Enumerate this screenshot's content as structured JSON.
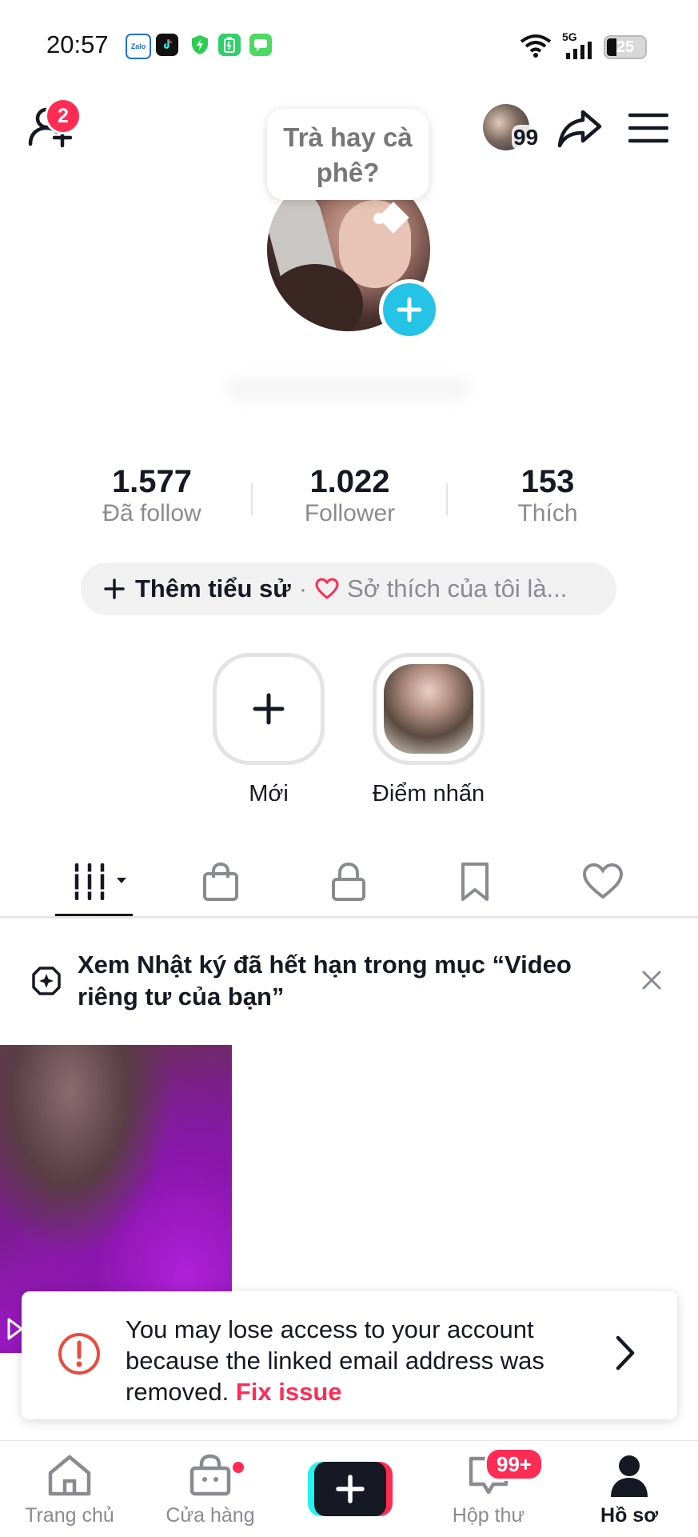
{
  "status_bar": {
    "time": "20:57",
    "battery": "25",
    "network": "5G",
    "app_icons": [
      "zalo-icon",
      "tiktok-icon",
      "shield-icon",
      "battery-app-icon",
      "messages-icon"
    ],
    "zalo_label": "Zalo"
  },
  "header": {
    "add_friend_badge": "2",
    "story_viewers_count": "99"
  },
  "profile": {
    "note_bubble": "Trà hay cà phê?",
    "stats": [
      {
        "value": "1.577",
        "label": "Đã follow"
      },
      {
        "value": "1.022",
        "label": "Follower"
      },
      {
        "value": "153",
        "label": "Thích"
      }
    ],
    "bio_add": "Thêm tiểu sử",
    "bio_separator": "·",
    "bio_interest": "Sở thích của tôi là..."
  },
  "highlights": [
    {
      "label": "Mới"
    },
    {
      "label": "Điểm nhấn"
    }
  ],
  "tabs": [
    "videos-grid-icon",
    "shop-bag-icon",
    "lock-icon",
    "bookmark-icon",
    "heart-icon"
  ],
  "notice": {
    "text": "Xem Nhật ký đã hết hạn trong mục “Video riêng tư của bạn”"
  },
  "toast": {
    "message": "You may lose access to your account because the linked email address was removed.",
    "action": "Fix issue"
  },
  "bottom_nav": {
    "items": [
      {
        "label": "Trang chủ"
      },
      {
        "label": "Cửa hàng"
      },
      {
        "label": ""
      },
      {
        "label": "Hộp thư",
        "badge": "99+"
      },
      {
        "label": "Hồ sơ"
      }
    ]
  },
  "colors": {
    "accent_red": "#fe2c55",
    "accent_cyan": "#25c3e6",
    "text_primary": "#161823",
    "text_secondary": "#8a8b91"
  }
}
